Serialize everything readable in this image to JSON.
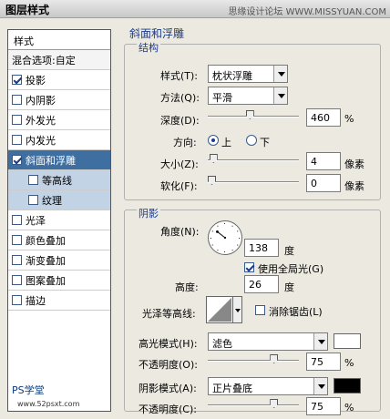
{
  "window": {
    "title": "图层样式",
    "watermark": "思缘设计论坛 WWW.MISSYUAN.COM"
  },
  "style_list": {
    "header": "样式",
    "blend_options": "混合选项:自定",
    "items": [
      {
        "label": "投影",
        "checked": true
      },
      {
        "label": "内阴影",
        "checked": false
      },
      {
        "label": "外发光",
        "checked": false
      },
      {
        "label": "内发光",
        "checked": false
      },
      {
        "label": "斜面和浮雕",
        "checked": true,
        "selected": true
      },
      {
        "label": "等高线",
        "checked": false,
        "sub": true
      },
      {
        "label": "纹理",
        "checked": false,
        "sub": true
      },
      {
        "label": "光泽",
        "checked": false
      },
      {
        "label": "颜色叠加",
        "checked": false
      },
      {
        "label": "渐变叠加",
        "checked": false
      },
      {
        "label": "图案叠加",
        "checked": false
      },
      {
        "label": "描边",
        "checked": false
      }
    ],
    "watermark": "PS学堂",
    "watermark_url": "www.52psxt.com"
  },
  "bevel": {
    "panel_title": "斜面和浮雕",
    "structure": {
      "title": "结构",
      "style_label": "样式(T):",
      "style_value": "枕状浮雕",
      "method_label": "方法(Q):",
      "method_value": "平滑",
      "depth_label": "深度(D):",
      "depth_value": "460",
      "depth_unit": "%",
      "depth_fraction": 0.46,
      "direction_label": "方向:",
      "direction_up": "上",
      "direction_down": "下",
      "direction_selected": "up",
      "size_label": "大小(Z):",
      "size_value": "4",
      "size_unit": "像素",
      "size_fraction": 0.02,
      "soften_label": "软化(F):",
      "soften_value": "0",
      "soften_unit": "像素",
      "soften_fraction": 0.0
    },
    "shading": {
      "title": "阴影",
      "angle_label": "角度(N):",
      "angle_value": "138",
      "angle_unit": "度",
      "global_light_label": "使用全局光(G)",
      "global_light_checked": true,
      "altitude_label": "高度:",
      "altitude_value": "26",
      "altitude_unit": "度",
      "gloss_contour_label": "光泽等高线:",
      "antialias_label": "消除锯齿(L)",
      "antialias_checked": false,
      "highlight_mode_label": "高光模式(H):",
      "highlight_mode_value": "滤色",
      "highlight_color": "#ffffff",
      "highlight_opacity_label": "不透明度(O):",
      "highlight_opacity_value": "75",
      "highlight_opacity_unit": "%",
      "highlight_opacity_fraction": 0.75,
      "shadow_mode_label": "阴影模式(A):",
      "shadow_mode_value": "正片叠底",
      "shadow_color": "#000000",
      "shadow_opacity_label": "不透明度(C):",
      "shadow_opacity_value": "75",
      "shadow_opacity_unit": "%",
      "shadow_opacity_fraction": 0.75
    }
  }
}
